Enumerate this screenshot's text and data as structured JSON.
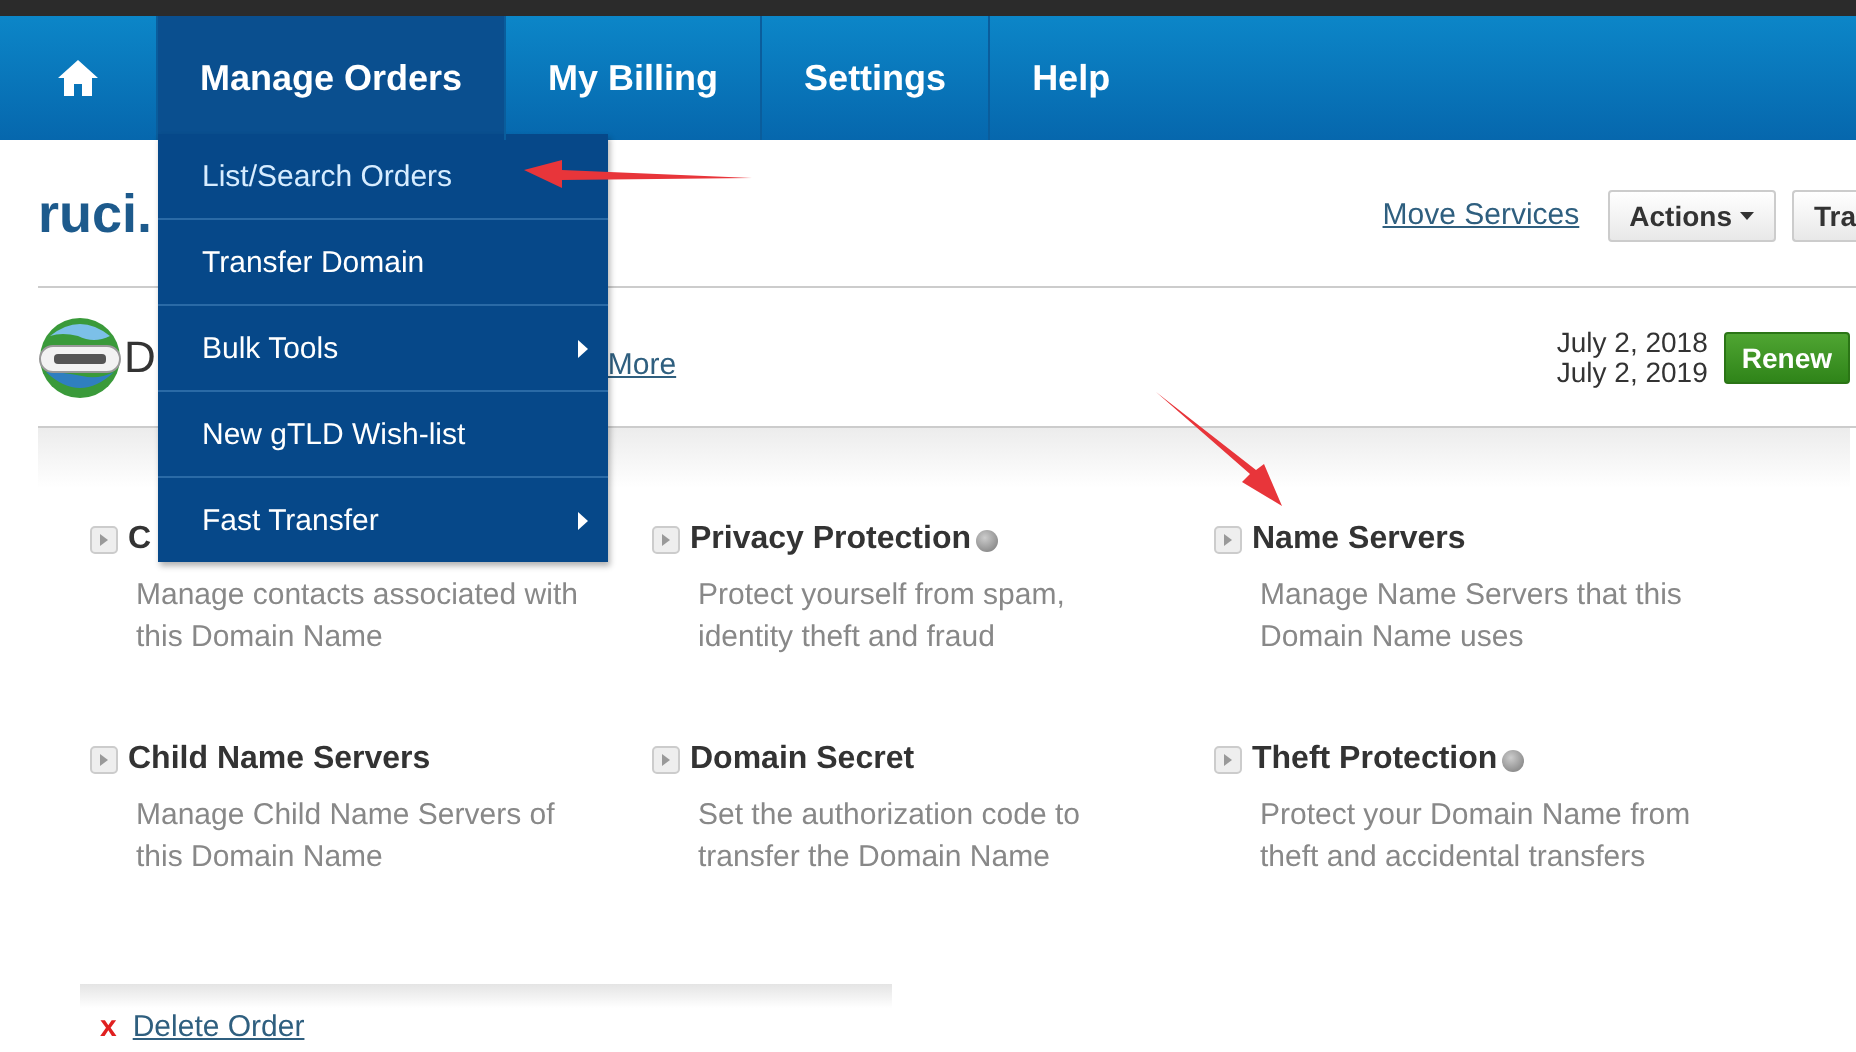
{
  "nav": {
    "items": [
      {
        "label": "Manage Orders",
        "selected": true
      },
      {
        "label": "My Billing",
        "selected": false
      },
      {
        "label": "Settings",
        "selected": false
      },
      {
        "label": "Help",
        "selected": false
      }
    ],
    "dropdown": [
      {
        "label": "List/Search Orders",
        "submenu": false
      },
      {
        "label": "Transfer Domain",
        "submenu": false
      },
      {
        "label": "Bulk Tools",
        "submenu": true
      },
      {
        "label": "New gTLD Wish-list",
        "submenu": false
      },
      {
        "label": "Fast Transfer",
        "submenu": true
      }
    ]
  },
  "header": {
    "title": "ruci.",
    "move_link": "Move Services",
    "buttons": [
      {
        "label": "Actions",
        "caret": true
      },
      {
        "label": "Tra",
        "caret": false
      }
    ]
  },
  "order": {
    "name": "D",
    "more_link": "More",
    "dates": [
      "July 2, 2018",
      "July 2, 2019"
    ],
    "renew": "Renew"
  },
  "services": [
    {
      "title": "C",
      "description": "Manage contacts associated with this Domain Name",
      "status_dot": false
    },
    {
      "title": "Privacy Protection",
      "description": "Protect yourself from spam, identity theft and fraud",
      "status_dot": true
    },
    {
      "title": "Name Servers",
      "description": "Manage Name Servers that this Domain Name uses",
      "status_dot": false
    },
    {
      "title": "Child Name Servers",
      "description": "Manage Child Name Servers of this Domain Name",
      "status_dot": false
    },
    {
      "title": "Domain Secret",
      "description": "Set the authorization code to transfer the Domain Name",
      "status_dot": false
    },
    {
      "title": "Theft Protection",
      "description": "Protect your Domain Name from theft and accidental transfers",
      "status_dot": true
    }
  ],
  "delete": {
    "mark": "x",
    "label": "Delete Order"
  }
}
